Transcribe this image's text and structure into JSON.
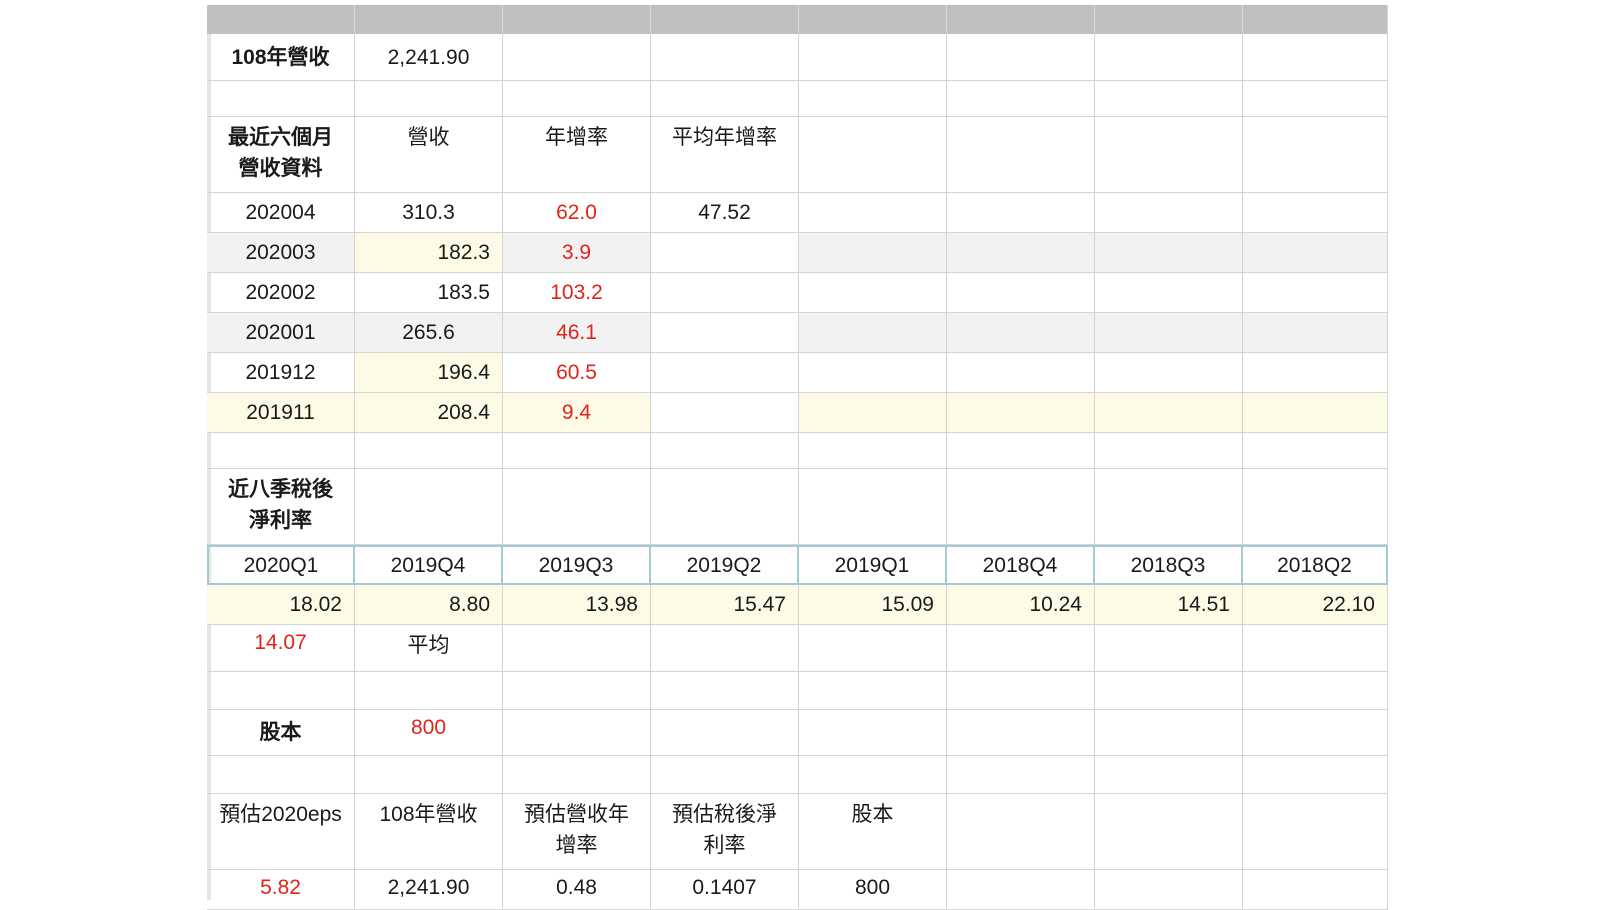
{
  "rev108": {
    "label": "108年營收",
    "value": "2,241.90"
  },
  "monthly": {
    "header": {
      "title": "最近六個月營收資料",
      "col_revenue": "營收",
      "col_yoy": "年增率",
      "col_avg_yoy": "平均年增率"
    },
    "rows": [
      {
        "month": "202004",
        "revenue": "310.3",
        "yoy": "62.0",
        "avg": "47.52"
      },
      {
        "month": "202003",
        "revenue": "182.3",
        "yoy": "3.9"
      },
      {
        "month": "202002",
        "revenue": "183.5",
        "yoy": "103.2"
      },
      {
        "month": "202001",
        "revenue": "265.6",
        "yoy": "46.1"
      },
      {
        "month": "201912",
        "revenue": "196.4",
        "yoy": "60.5"
      },
      {
        "month": "201911",
        "revenue": "208.4",
        "yoy": "9.4"
      }
    ]
  },
  "quarters": {
    "title": "近八季稅後淨利率",
    "labels": [
      "2020Q1",
      "2019Q4",
      "2019Q3",
      "2019Q2",
      "2019Q1",
      "2018Q4",
      "2018Q3",
      "2018Q2"
    ],
    "values": [
      "18.02",
      "8.80",
      "13.98",
      "15.47",
      "15.09",
      "10.24",
      "14.51",
      "22.10"
    ],
    "average_value": "14.07",
    "average_label": "平均"
  },
  "capital": {
    "label": "股本",
    "value": "800"
  },
  "estimate": {
    "headers": [
      "預估2020eps",
      "108年營收",
      "預估營收年增率",
      "預估稅後淨利率",
      "股本"
    ],
    "values": [
      "5.82",
      "2,241.90",
      "0.48",
      "0.1407",
      "800"
    ]
  },
  "colors": {
    "red_text": "#e0241b",
    "yellow_fill": "#fdfbe6",
    "gray_fill": "#f2f2f2",
    "header_bar": "#c0c0c0",
    "quarter_border": "#9ecbd6"
  }
}
